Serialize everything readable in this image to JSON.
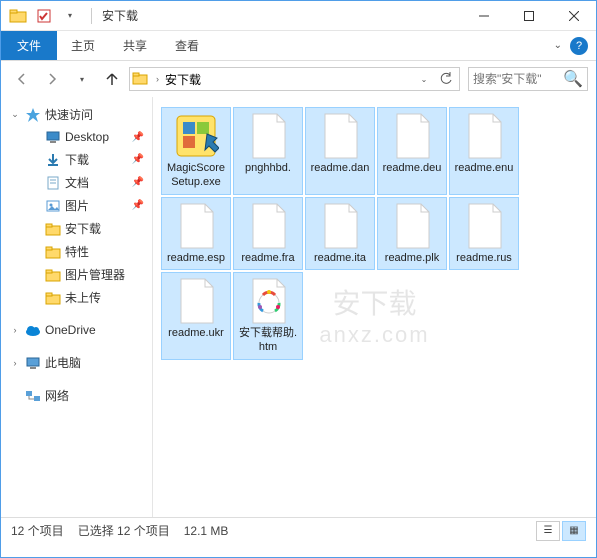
{
  "window": {
    "title": "安下载"
  },
  "ribbon": {
    "file": "文件",
    "tabs": [
      "主页",
      "共享",
      "查看"
    ]
  },
  "address": {
    "crumb": "安下载"
  },
  "search": {
    "placeholder": "搜索\"安下载\""
  },
  "sidebar": {
    "quick_access": "快速访问",
    "items": [
      {
        "label": "Desktop",
        "icon": "desktop",
        "pinned": true
      },
      {
        "label": "下载",
        "icon": "downloads",
        "pinned": true
      },
      {
        "label": "文档",
        "icon": "documents",
        "pinned": true
      },
      {
        "label": "图片",
        "icon": "pictures",
        "pinned": true
      },
      {
        "label": "安下载",
        "icon": "folder",
        "pinned": false
      },
      {
        "label": "特性",
        "icon": "folder",
        "pinned": false
      },
      {
        "label": "图片管理器",
        "icon": "folder",
        "pinned": false
      },
      {
        "label": "未上传",
        "icon": "folder",
        "pinned": false
      }
    ],
    "onedrive": "OneDrive",
    "this_pc": "此电脑",
    "network": "网络"
  },
  "files": [
    {
      "name": "MagicScoreSetup.exe",
      "type": "exe"
    },
    {
      "name": "pnghhbd.",
      "type": "blank"
    },
    {
      "name": "readme.dan",
      "type": "blank"
    },
    {
      "name": "readme.deu",
      "type": "blank"
    },
    {
      "name": "readme.enu",
      "type": "blank"
    },
    {
      "name": "readme.esp",
      "type": "blank"
    },
    {
      "name": "readme.fra",
      "type": "blank"
    },
    {
      "name": "readme.ita",
      "type": "blank"
    },
    {
      "name": "readme.plk",
      "type": "blank"
    },
    {
      "name": "readme.rus",
      "type": "blank"
    },
    {
      "name": "readme.ukr",
      "type": "blank"
    },
    {
      "name": "安下载帮助.htm",
      "type": "htm"
    }
  ],
  "status": {
    "count": "12 个项目",
    "selected": "已选择 12 个项目",
    "size": "12.1 MB"
  },
  "watermark": {
    "line1": "安下载",
    "line2": "anxz.com"
  }
}
